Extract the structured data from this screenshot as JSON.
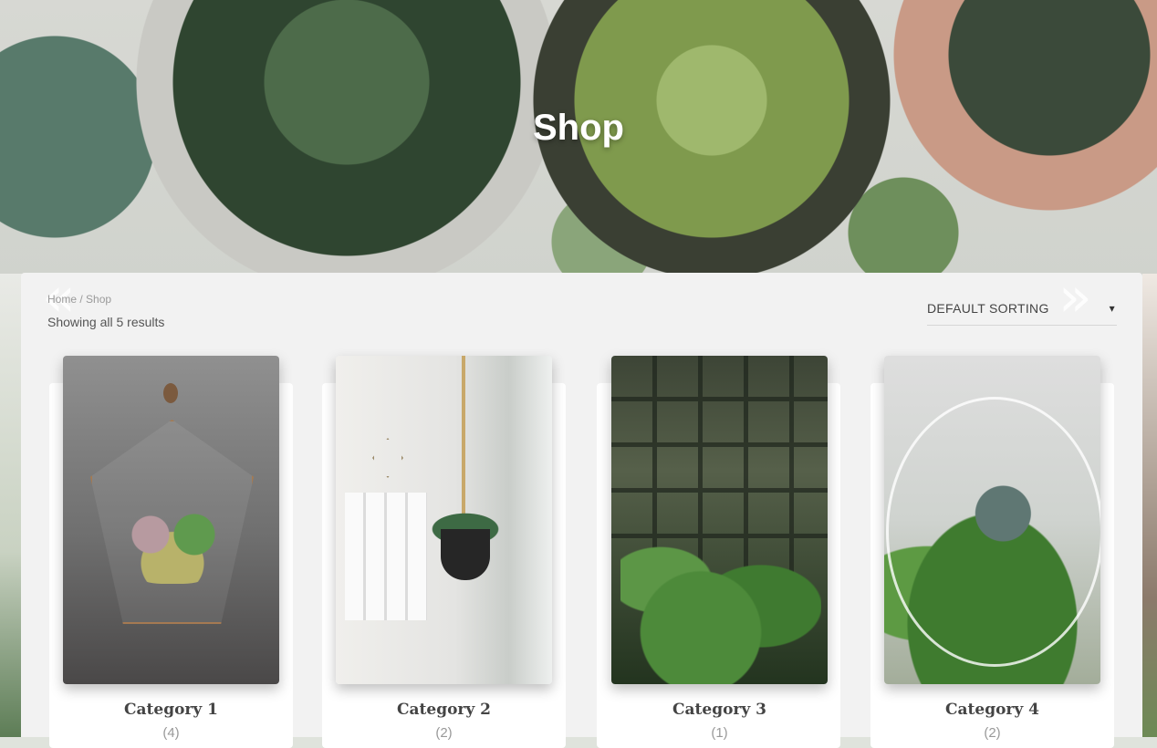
{
  "page": {
    "title": "Shop"
  },
  "breadcrumb": {
    "home": "Home",
    "separator": "/",
    "current": "Shop"
  },
  "nav": {
    "prev_glyph": "«",
    "next_glyph": "»"
  },
  "results": {
    "text": "Showing all 5 results"
  },
  "sorting": {
    "selected": "DEFAULT SORTING",
    "caret": "▾"
  },
  "categories": [
    {
      "name": "Category 1",
      "count": "(4)"
    },
    {
      "name": "Category 2",
      "count": "(2)"
    },
    {
      "name": "Category 3",
      "count": "(1)"
    },
    {
      "name": "Category 4",
      "count": "(2)"
    }
  ],
  "colors": {
    "panel_bg": "#f2f2f2",
    "title_text": "#ffffff",
    "category_text": "#444444"
  }
}
